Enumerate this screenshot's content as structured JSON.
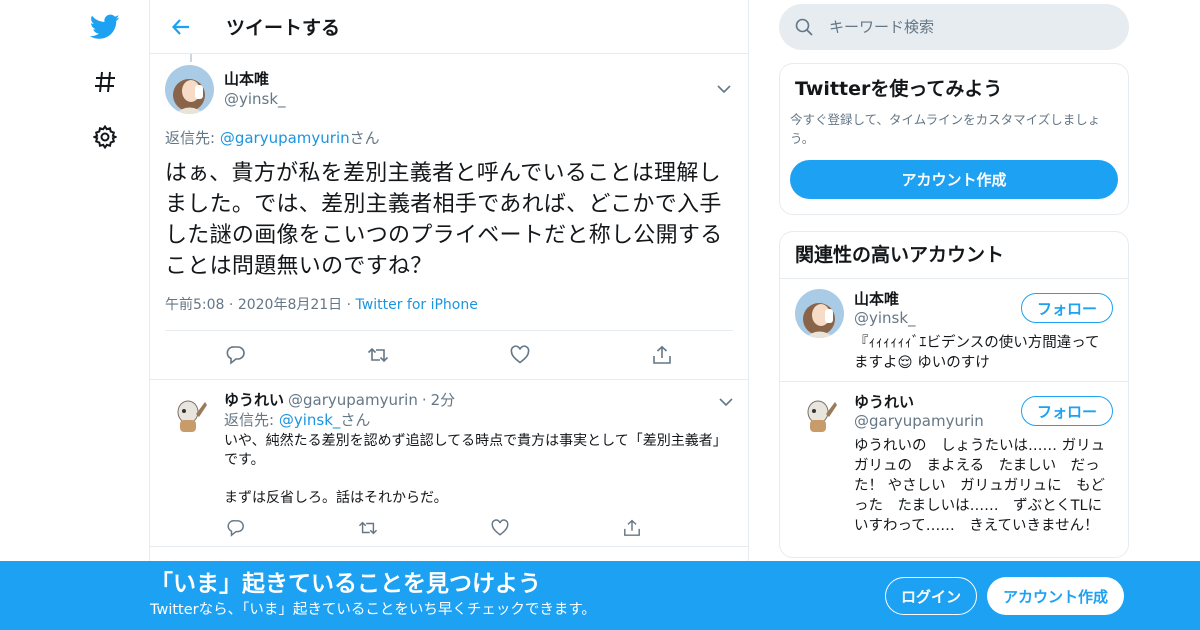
{
  "header": {
    "title": "ツイートする"
  },
  "nav": {
    "icons": [
      "twitter-logo-icon",
      "hashtag-icon",
      "settings-icon"
    ]
  },
  "tweet": {
    "name": "山本唯",
    "handle": "@yinsk_",
    "reply_to_prefix": "返信先: ",
    "reply_to_handle": "@garyupamyurin",
    "reply_to_suffix": "さん",
    "text": "はぁ、貴方が私を差別主義者と呼んでいることは理解しました。では、差別主義者相手であれば、どこかで入手した謎の画像をこいつのプライベートだと称し公開することは問題無いのですね？",
    "time": "午前5:08",
    "date": "2020年8月21日",
    "source": "Twitter for iPhone",
    "dot": "·"
  },
  "reply": {
    "name": "ゆうれい",
    "handle": "@garyupamyurin",
    "dot": "·",
    "age": "2分",
    "reply_to_prefix": "返信先: ",
    "reply_to_handle": "@yinsk_",
    "reply_to_suffix": "さん",
    "text": "いや、純然たる差別を認めず追認してる時点で貴方は事実として「差別主義者」です。\n\nまずは反省しろ。話はそれからだ。"
  },
  "search": {
    "placeholder": "キーワード検索"
  },
  "signup_card": {
    "title": "Twitterを使ってみよう",
    "description": "今すぐ登録して、タイムラインをカスタマイズしましょう。",
    "button": "アカウント作成"
  },
  "related": {
    "title": "関連性の高いアカウント",
    "accounts": [
      {
        "name": "山本唯",
        "handle": "@yinsk_",
        "bio": "『ｨｨｨｨｨｨﾞｴビデンスの使い方間違ってますよ😌 ゆいのすけ",
        "follow": "フォロー"
      },
      {
        "name": "ゆうれい",
        "handle": "@garyupamyurin",
        "bio": "ゆうれいの　しょうたいは…… ガリュガリュの　まよえる　たましい　だった！ やさしい　ガリュガリュに　もどった　たましいは……　ずぶとくTLにいすわって……　きえていきません！",
        "follow": "フォロー"
      }
    ]
  },
  "banner": {
    "title": "「いま」起きていることを見つけよう",
    "subtitle": "Twitterなら、「いま」起きていることをいち早くチェックできます。",
    "login": "ログイン",
    "signup": "アカウント作成"
  },
  "colors": {
    "accent": "#1da1f2",
    "link": "#1b95e0",
    "muted": "#657786",
    "border": "#e6ecf0"
  }
}
